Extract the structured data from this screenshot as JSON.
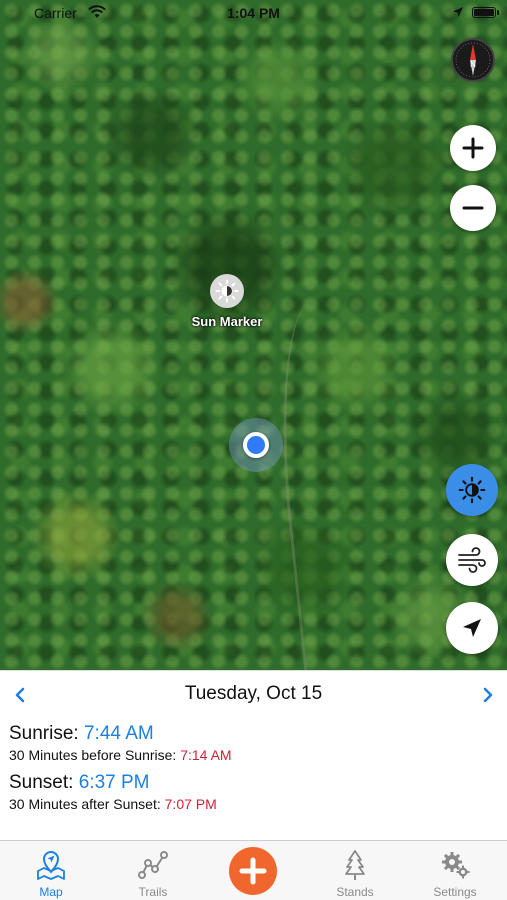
{
  "status_bar": {
    "carrier": "Carrier",
    "time": "1:04 PM"
  },
  "map": {
    "compass_label": "N",
    "sun_marker_label": "Sun Marker",
    "controls": {
      "zoom_in_icon": "plus-icon",
      "zoom_out_icon": "minus-icon",
      "sun_toggle_icon": "sun-icon",
      "wind_icon": "wind-icon",
      "locate_icon": "location-arrow-icon"
    }
  },
  "panel": {
    "date": "Tuesday, Oct 15",
    "sunrise_label": "Sunrise: ",
    "sunrise_time": "7:44 AM",
    "before_sunrise_label": "30 Minutes before Sunrise: ",
    "before_sunrise_time": "7:14 AM",
    "sunset_label": "Sunset: ",
    "sunset_time": "6:37 PM",
    "after_sunset_label": "30 Minutes after Sunset: ",
    "after_sunset_time": "7:07 PM"
  },
  "tabs": [
    {
      "label": "Map",
      "icon": "map-pin-icon",
      "active": true
    },
    {
      "label": "Trails",
      "icon": "trail-icon",
      "active": false
    },
    {
      "label": "Stands",
      "icon": "tree-icon",
      "active": false
    },
    {
      "label": "Settings",
      "icon": "gears-icon",
      "active": false
    }
  ],
  "colors": {
    "accent_blue": "#1d7fe0",
    "time_red": "#d0213a",
    "add_orange": "#f0662c",
    "active_toggle": "#3a8ee6"
  }
}
